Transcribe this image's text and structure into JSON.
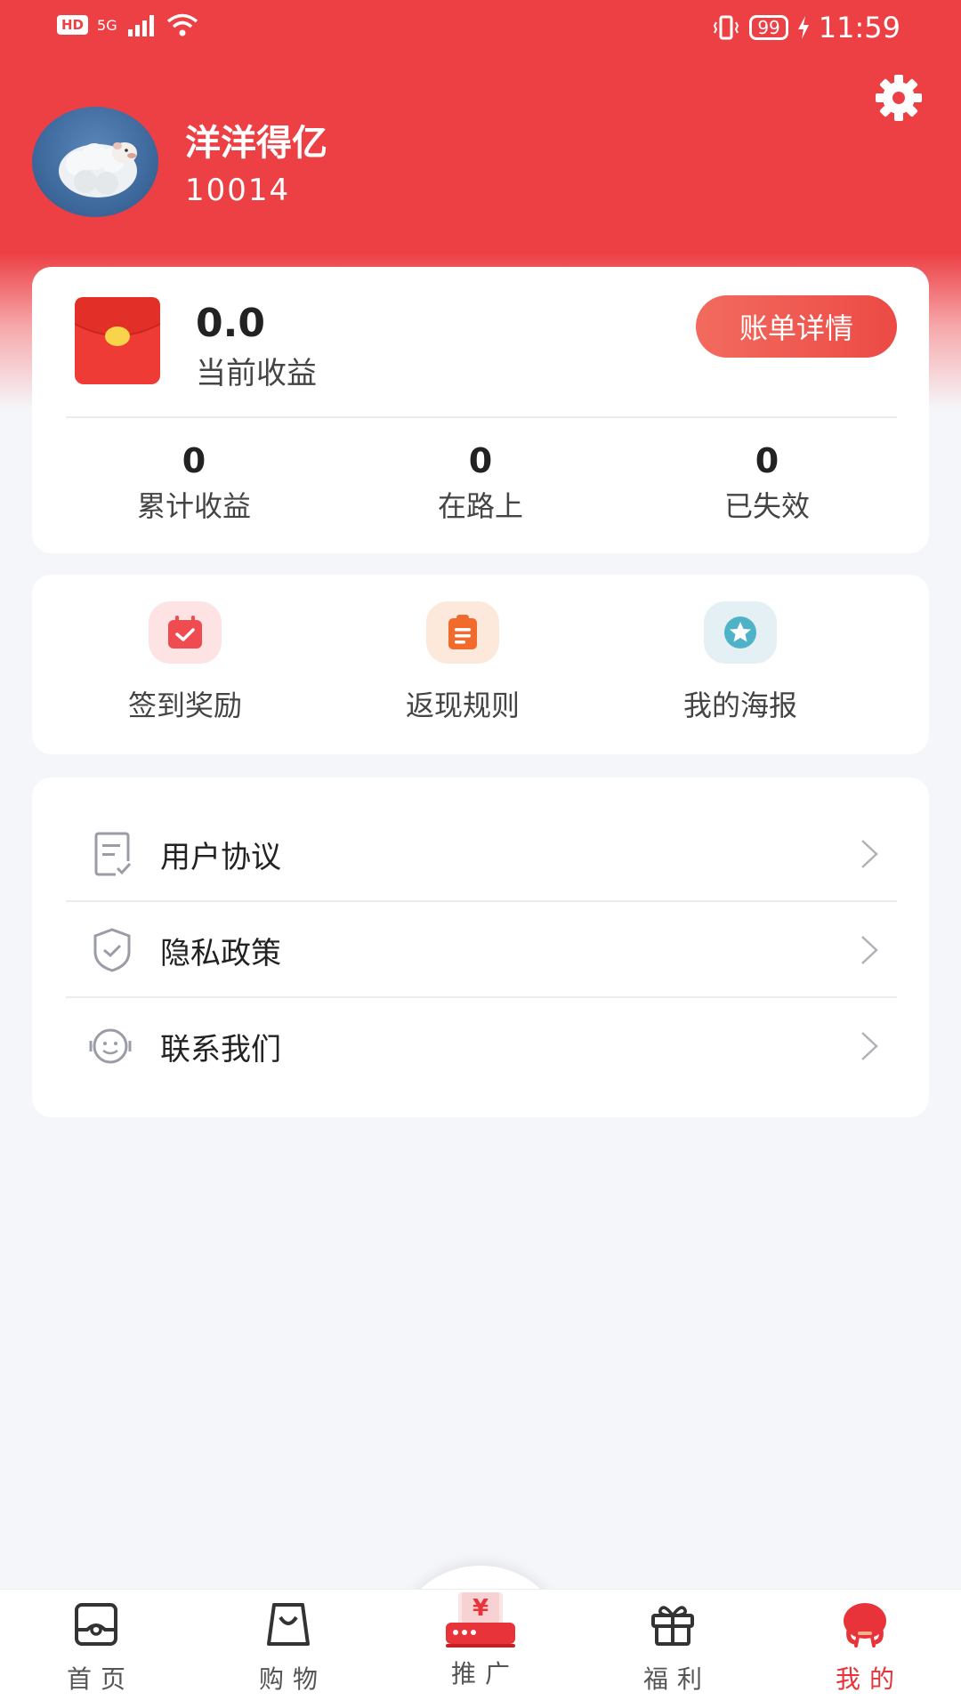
{
  "status_bar": {
    "hd": "HD",
    "network": "5G",
    "battery": "99",
    "time": "11:59"
  },
  "profile": {
    "name": "洋洋得亿",
    "user_id": "10014"
  },
  "earnings": {
    "current_value": "0.0",
    "current_label": "当前收益",
    "bill_button": "账单详情",
    "stats": [
      {
        "value": "0",
        "label": "累计收益"
      },
      {
        "value": "0",
        "label": "在路上"
      },
      {
        "value": "0",
        "label": "已失效"
      }
    ]
  },
  "quick_actions": [
    {
      "label": "签到奖励",
      "icon": "calendar-check-icon",
      "bg": "#fde3e4",
      "fg": "#ef4b50"
    },
    {
      "label": "返现规则",
      "icon": "clipboard-icon",
      "bg": "#fde8dc",
      "fg": "#f36b2c"
    },
    {
      "label": "我的海报",
      "icon": "star-badge-icon",
      "bg": "#e5f0f5",
      "fg": "#4fb3c7"
    }
  ],
  "menu": [
    {
      "label": "用户协议",
      "icon": "document-check-icon"
    },
    {
      "label": "隐私政策",
      "icon": "shield-check-icon"
    },
    {
      "label": "联系我们",
      "icon": "headset-smile-icon"
    }
  ],
  "tabbar": [
    {
      "label": "首页",
      "icon": "home-icon",
      "active": false
    },
    {
      "label": "购物",
      "icon": "shopping-bag-icon",
      "active": false
    },
    {
      "label": "推广",
      "icon": "promote-yen-icon",
      "active": false
    },
    {
      "label": "福利",
      "icon": "gift-icon",
      "active": false
    },
    {
      "label": "我的",
      "icon": "profile-mascot-icon",
      "active": true
    }
  ],
  "colors": {
    "brand_red": "#ec4045",
    "active_tab": "#e8333a"
  }
}
